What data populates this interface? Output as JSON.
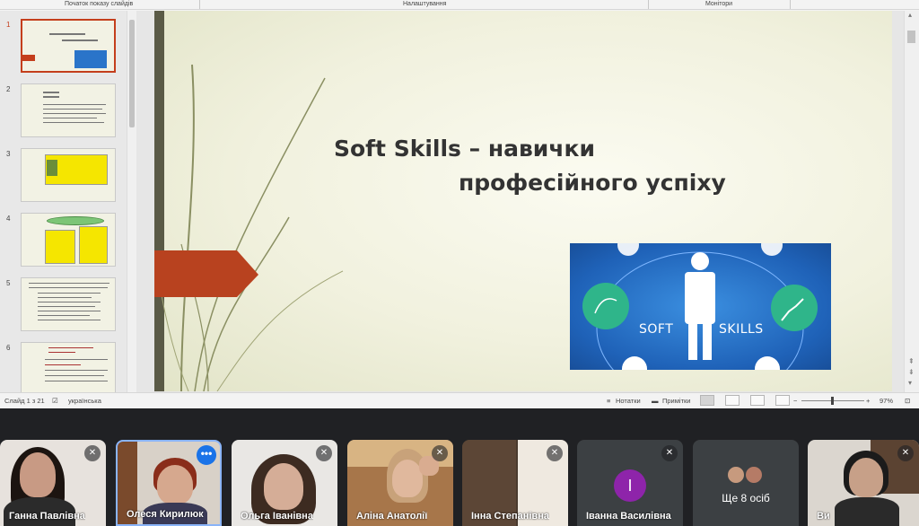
{
  "ribbon": {
    "groups": [
      "Початок показу слайдів",
      "Налаштування",
      "Монітори"
    ]
  },
  "thumbnails": [
    {
      "number": "1",
      "active": true
    },
    {
      "number": "2",
      "active": false
    },
    {
      "number": "3",
      "active": false
    },
    {
      "number": "4",
      "active": false
    },
    {
      "number": "5",
      "active": false
    },
    {
      "number": "6",
      "active": false
    }
  ],
  "slide": {
    "title_line1": "Soft Skills – навички",
    "title_line2": "професійного успіху",
    "image_words": [
      "SOFT",
      "SKILLS"
    ]
  },
  "status": {
    "slide_counter": "Слайд 1 з 21",
    "language": "українська",
    "notes": "Нотатки",
    "comments": "Примітки",
    "zoom": "97%"
  },
  "participants": [
    {
      "name": "Ганна Павлівна",
      "muted": true,
      "kind": "video"
    },
    {
      "name": "Олеся Кирилюк",
      "muted": false,
      "kind": "video",
      "active": true
    },
    {
      "name": "Ольга Іванівна",
      "muted": true,
      "kind": "video"
    },
    {
      "name": "Аліна Анатолії",
      "muted": true,
      "kind": "video"
    },
    {
      "name": "Інна Степанівна",
      "muted": true,
      "kind": "video"
    },
    {
      "name": "Іванна Василівна",
      "muted": true,
      "kind": "avatar",
      "initial": "І",
      "color": "#8e24aa"
    },
    {
      "name": "Ще 8 осіб",
      "muted": false,
      "kind": "more"
    },
    {
      "name": "Ви",
      "muted": true,
      "kind": "video"
    }
  ],
  "colors": {
    "accent": "#c43e1c",
    "meet_bg": "#202124",
    "tile_bg": "#3c4043",
    "highlight": "#1a73e8"
  }
}
